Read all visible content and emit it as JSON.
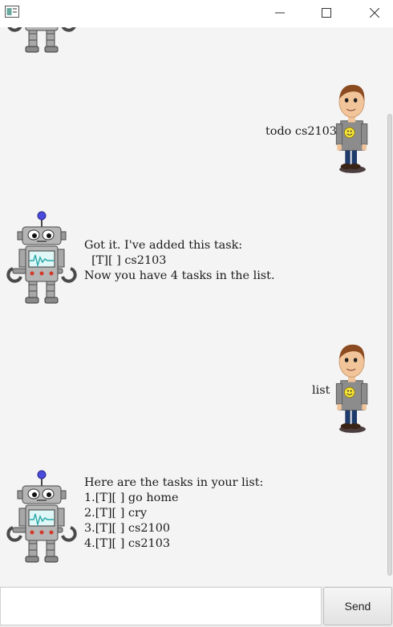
{
  "window": {
    "icons": {
      "app": "app-icon",
      "minimize": "minimize-icon",
      "maximize": "maximize-icon",
      "close": "close-icon"
    }
  },
  "messages": [
    {
      "sender": "user",
      "lines": [
        "todo cs2103"
      ],
      "avatar": "user-avatar-icon"
    },
    {
      "sender": "bot",
      "lines": [
        "Got it. I've added this task:",
        "  [T][ ] cs2103",
        "Now you have 4 tasks in the list."
      ],
      "avatar": "robot-avatar-icon"
    },
    {
      "sender": "user",
      "lines": [
        "list"
      ],
      "avatar": "user-avatar-icon"
    },
    {
      "sender": "bot",
      "lines": [
        "Here are the tasks in your list:",
        "1.[T][ ] go home",
        "2.[T][ ] cry",
        "3.[T][ ] cs2100",
        "4.[T][ ] cs2103"
      ],
      "avatar": "robot-avatar-icon"
    }
  ],
  "input": {
    "value": "",
    "placeholder": ""
  },
  "send_button": {
    "label": "Send"
  },
  "colors": {
    "background": "#f4f4f4",
    "input_background": "#ffffff",
    "button_border": "#bdbdbd"
  }
}
